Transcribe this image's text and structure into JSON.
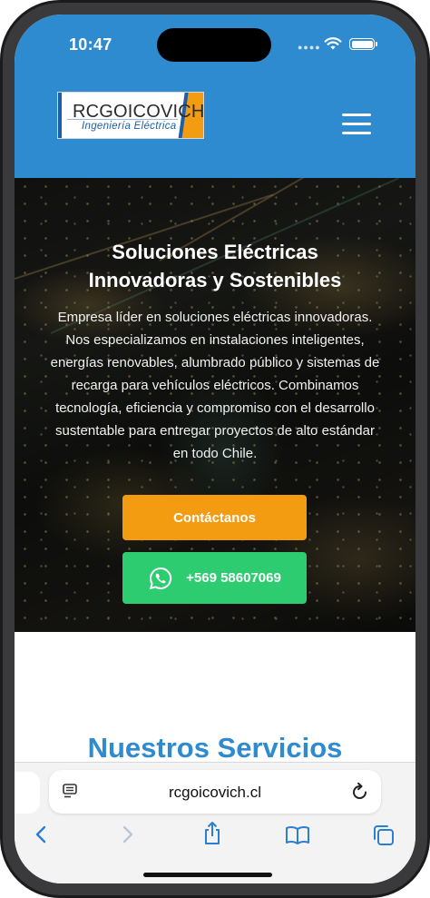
{
  "status_bar": {
    "time": "10:47"
  },
  "header": {
    "logo": {
      "brand": "RCGOICOVICH",
      "tagline": "Ingeniería Eléctrica"
    },
    "menu_icon": "hamburger-menu-icon"
  },
  "hero": {
    "title_line1": "Soluciones Eléctricas",
    "title_line2": "Innovadoras y Sostenibles",
    "description": "Empresa líder en soluciones eléctricas innovadoras. Nos especializamos en instalaciones inteligentes, energías renovables, alumbrado público y sistemas de recarga para vehículos eléctricos. Combinamos tecnología, eficiencia y compromiso con el desarrollo sustentable para entregar proyectos de alto estándar en todo Chile.",
    "contact_button": "Contáctanos",
    "whatsapp_button": "+569 58607069"
  },
  "services": {
    "title": "Nuestros Servicios"
  },
  "browser": {
    "url": "rcgoicovich.cl",
    "icons": [
      "reader-icon",
      "reload-icon",
      "back-icon",
      "forward-icon",
      "share-icon",
      "bookmarks-icon",
      "tabs-icon"
    ]
  },
  "colors": {
    "header_blue": "#2f8bd0",
    "contact_orange": "#f39c12",
    "whatsapp_green": "#2ecc71",
    "services_title_blue": "#2f8bd0"
  }
}
